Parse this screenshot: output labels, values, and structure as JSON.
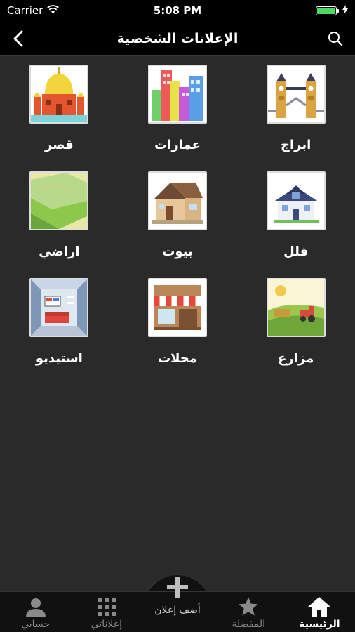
{
  "status": {
    "carrier": "Carrier",
    "time": "5:08 PM",
    "battery_level": 1.0
  },
  "nav": {
    "title": "الإعلانات الشخصية",
    "back_icon": "chevron-left-icon",
    "search_icon": "search-icon"
  },
  "categories": [
    {
      "label": "ابراج",
      "icon": "tower-bridge"
    },
    {
      "label": "عمارات",
      "icon": "buildings"
    },
    {
      "label": "قصر",
      "icon": "palace"
    },
    {
      "label": "فلل",
      "icon": "villa"
    },
    {
      "label": "بيوت",
      "icon": "house"
    },
    {
      "label": "اراضي",
      "icon": "land"
    },
    {
      "label": "مزارع",
      "icon": "farm"
    },
    {
      "label": "محلات",
      "icon": "shop"
    },
    {
      "label": "استيديو",
      "icon": "studio"
    }
  ],
  "tabs": {
    "account": "حسابي",
    "my_ads": "إعلاناتي",
    "add": "أضف إعلان",
    "favorites": "المفضلة",
    "home": "الرئيسية"
  },
  "colors": {
    "active_tab": "#ffffff",
    "inactive_tab": "#8a8a8a",
    "background": "#2a2a2a",
    "bar": "#000000"
  }
}
